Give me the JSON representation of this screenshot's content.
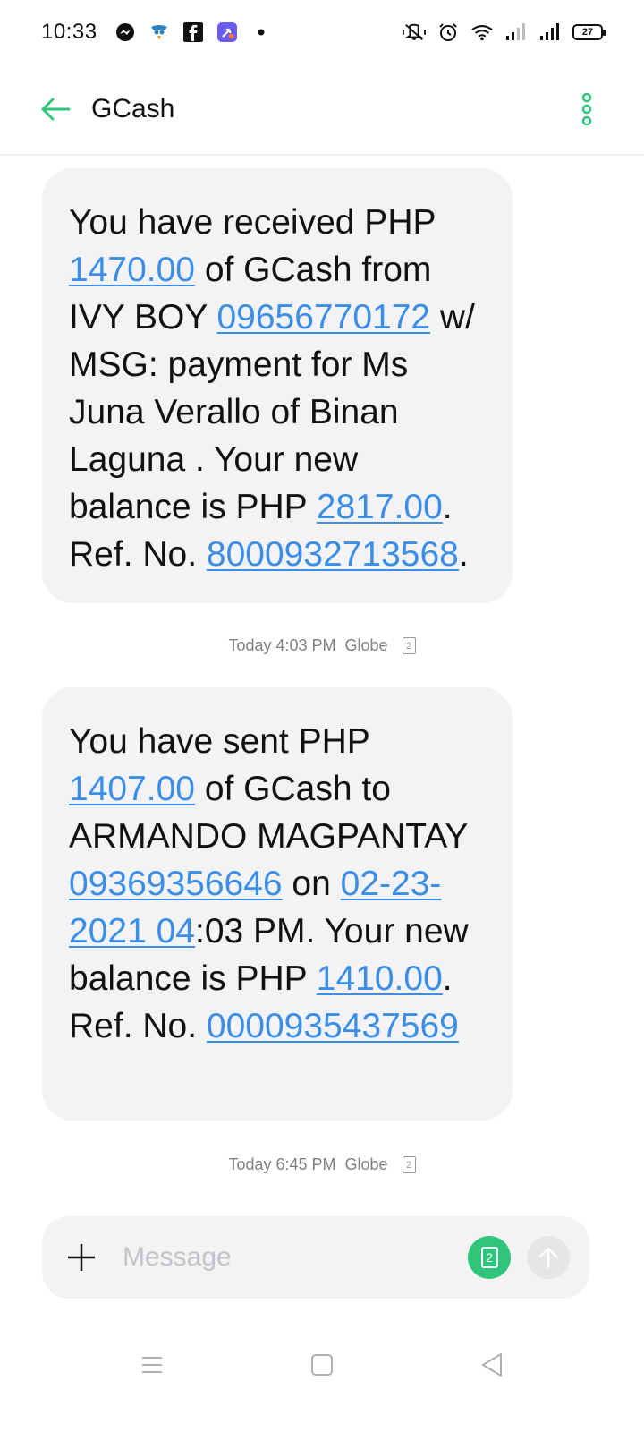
{
  "status_bar": {
    "time": "10:33",
    "battery": "27",
    "left_icons": [
      "messenger-icon",
      "bird-app-icon",
      "facebook-icon",
      "shortcut-app-icon",
      "dot-icon"
    ],
    "right_icons": [
      "vibrate-mute-icon",
      "alarm-icon",
      "wifi-icon",
      "signal-icon",
      "signal-icon"
    ]
  },
  "header": {
    "title": "GCash",
    "accent_color": "#2fc67b"
  },
  "messages": [
    {
      "segments": [
        {
          "text": "You have received PHP ",
          "link": false
        },
        {
          "text": "1470.00",
          "link": true
        },
        {
          "text": " of GCash from IVY BOY ",
          "link": false
        },
        {
          "text": "09656770172",
          "link": true
        },
        {
          "text": " w/ MSG: payment for Ms Juna Verallo of Binan Laguna . Your new balance is PHP ",
          "link": false
        },
        {
          "text": "2817.00",
          "link": true
        },
        {
          "text": ". Ref. No. ",
          "link": false
        },
        {
          "text": "8000932713568",
          "link": true
        },
        {
          "text": ".",
          "link": false
        }
      ],
      "meta": {
        "time": "Today 4:03 PM",
        "carrier": "Globe",
        "sim": "2"
      }
    },
    {
      "segments": [
        {
          "text": "You have sent PHP ",
          "link": false
        },
        {
          "text": "1407.00",
          "link": true
        },
        {
          "text": " of GCash to ARMANDO MAGPANTAY ",
          "link": false
        },
        {
          "text": "09369356646",
          "link": true
        },
        {
          "text": " on ",
          "link": false
        },
        {
          "text": "02-23-2021 04",
          "link": true
        },
        {
          "text": ":03 PM. Your new balance is PHP ",
          "link": false
        },
        {
          "text": "1410.00",
          "link": true
        },
        {
          "text": ". Ref. No. ",
          "link": false
        },
        {
          "text": "0000935437569",
          "link": true
        }
      ],
      "meta": {
        "time": "Today 6:45 PM",
        "carrier": "Globe",
        "sim": "2"
      }
    }
  ],
  "composer": {
    "placeholder": "Message",
    "sim_label": "2"
  },
  "link_color": "#3a8ee6"
}
